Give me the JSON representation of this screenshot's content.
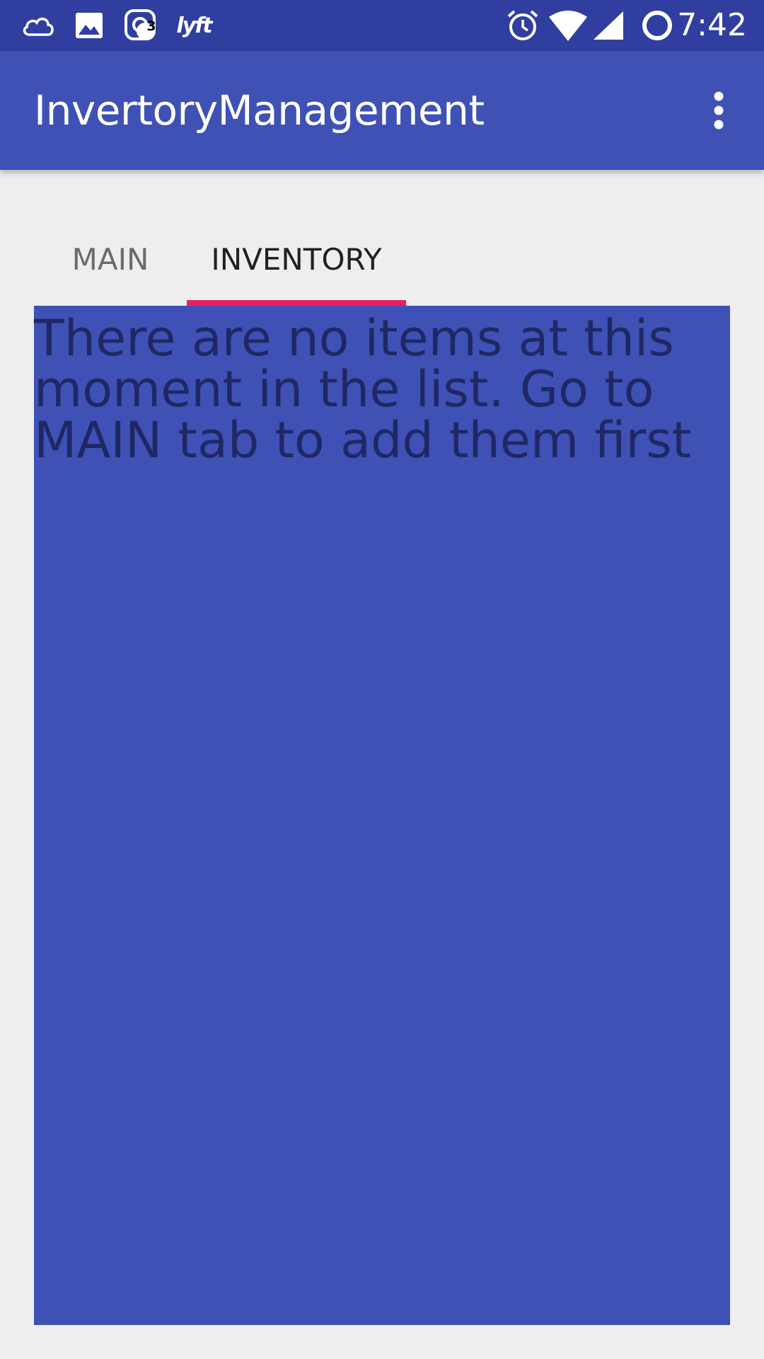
{
  "status_bar": {
    "left_icons": [
      "cloud-icon",
      "image-icon",
      "instagram-notification-icon",
      "lyft-icon"
    ],
    "notification_count": "3",
    "lyft_label": "lyft",
    "right_icons": [
      "alarm-icon",
      "wifi-icon",
      "cell-signal-icon",
      "battery-ring-icon"
    ],
    "time": "7:42"
  },
  "app_bar": {
    "title": "InvertoryManagement",
    "overflow_icon": "more-vert-icon"
  },
  "tabs": {
    "items": [
      {
        "label": "MAIN",
        "selected": false
      },
      {
        "label": "INVENTORY",
        "selected": true
      }
    ],
    "indicator_color": "#e91e63"
  },
  "content": {
    "empty_message": "There are no items at this moment in the list. Go to MAIN tab to add them first"
  },
  "colors": {
    "status_bar": "#303f9f",
    "primary": "#3f51b5",
    "background": "#eeeeee",
    "message_text": "#1f2865"
  }
}
